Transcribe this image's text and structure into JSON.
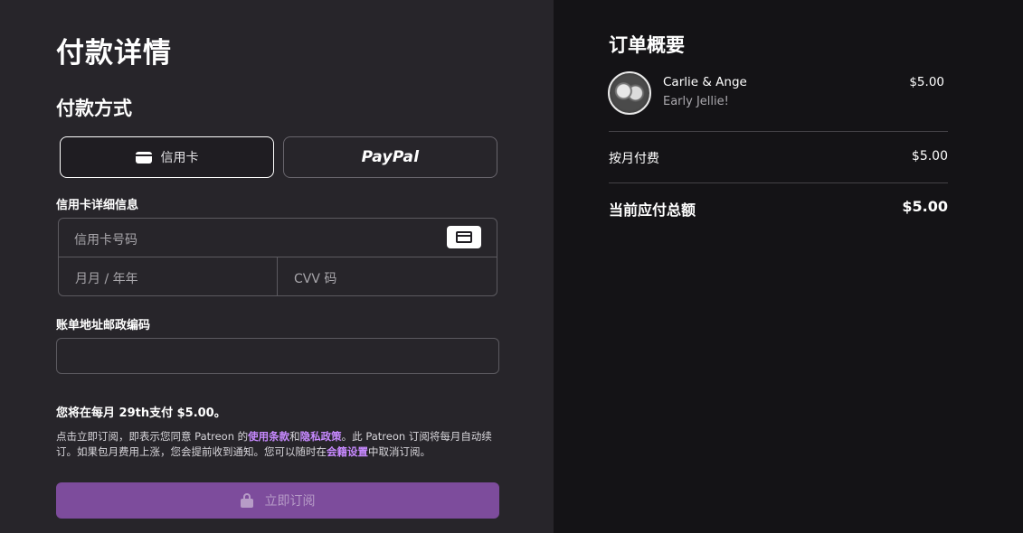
{
  "payment": {
    "title": "付款详情",
    "method_section_title": "付款方式",
    "methods": {
      "card_label": "信用卡",
      "paypal_label": "PayPal",
      "selected": "card"
    },
    "card_details_label": "信用卡详细信息",
    "card_number_placeholder": "信用卡号码",
    "expiry_placeholder": "月月 / 年年",
    "cvv_placeholder": "CVV 码",
    "zip_label": "账单地址邮政编码",
    "zip_value": "",
    "charge_note": "您将在每月 29th支付 $5.00。",
    "terms": {
      "part1": "点击立即订阅，即表示您同意 Patreon 的",
      "terms_link": "使用条款",
      "part2": "和",
      "privacy_link": "隐私政策",
      "part3": "。此 Patreon 订阅将每月自动续订。如果包月费用上涨，您会提前收到通知。您可以随时在",
      "membership_link": "会籍设置",
      "part4": "中取消订阅。"
    },
    "subscribe_label": "立即订阅"
  },
  "summary": {
    "title": "订单概要",
    "creator_name": "Carlie & Ange",
    "tier_name": "Early Jellie!",
    "tier_price": "$5.00",
    "monthly_label": "按月付费",
    "monthly_value": "$5.00",
    "total_label": "当前应付总额",
    "total_value": "$5.00"
  },
  "colors": {
    "left_bg": "#27252a",
    "right_bg": "#141316",
    "accent_link": "#c789ff",
    "subscribe_bg": "#7d4c9c"
  },
  "icons": [
    "credit-card-icon",
    "lock-icon"
  ]
}
